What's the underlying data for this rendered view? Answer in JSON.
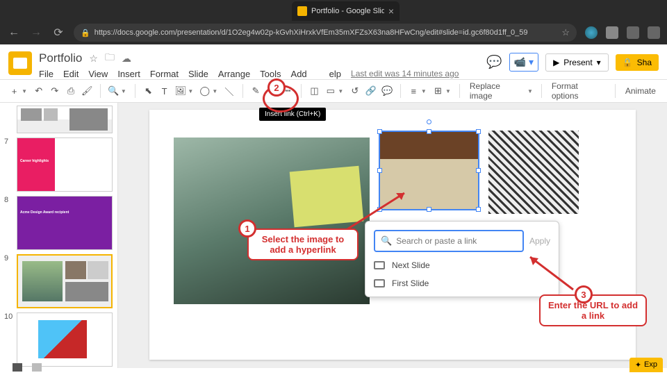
{
  "browser": {
    "tab_title": "Portfolio - Google Slides",
    "url": "https://docs.google.com/presentation/d/1O2eg4w02p-kGvhXiHrxkVfEm35mXFZsX63na8HFwCng/edit#slide=id.gc6f80d1ff_0_59"
  },
  "doc": {
    "title": "Portfolio",
    "menus": [
      "File",
      "Edit",
      "View",
      "Insert",
      "Format",
      "Slide",
      "Arrange",
      "Tools",
      "Add",
      "elp"
    ],
    "last_edit": "Last edit was 14 minutes ago",
    "present_label": "Present",
    "share_label": "Sha"
  },
  "toolbar": {
    "replace_image": "Replace image",
    "format_options": "Format options",
    "animate": "Animate",
    "tooltip": "Insert link (Ctrl+K)"
  },
  "thumbs": {
    "n6": "",
    "n7": "7",
    "n8": "8",
    "n9": "9",
    "n10": "10",
    "t7_label": "Career highlights",
    "t8_label": "Acme Design Award recipient"
  },
  "link_popup": {
    "placeholder": "Search or paste a link",
    "apply": "Apply",
    "opt1": "Next Slide",
    "opt2": "First Slide"
  },
  "annotations": {
    "n1": "1",
    "t1": "Select the image to add a hyperlink",
    "n2": "2",
    "n3": "3",
    "t3": "Enter the URL to add a link"
  },
  "bottom": {
    "explore": "Exp"
  }
}
